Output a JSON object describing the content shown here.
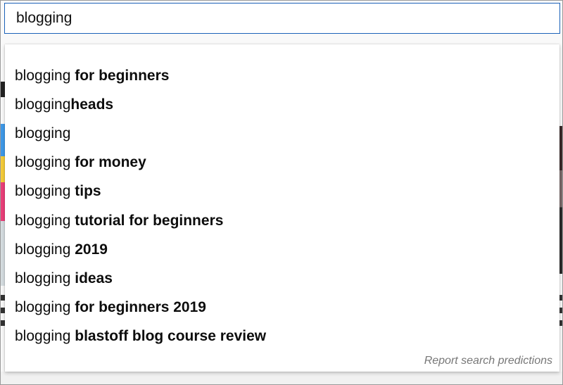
{
  "search": {
    "value": "blogging"
  },
  "suggestions": [
    {
      "base": "blogging",
      "rest": " for beginners"
    },
    {
      "base": "blogging",
      "rest": "heads"
    },
    {
      "base": "blogging",
      "rest": ""
    },
    {
      "base": "blogging",
      "rest": " for money"
    },
    {
      "base": "blogging",
      "rest": " tips"
    },
    {
      "base": "blogging",
      "rest": " tutorial for beginners"
    },
    {
      "base": "blogging",
      "rest": " 2019"
    },
    {
      "base": "blogging",
      "rest": " ideas"
    },
    {
      "base": "blogging",
      "rest": " for beginners 2019"
    },
    {
      "base": "blogging",
      "rest": " blastoff blog course review"
    }
  ],
  "report_link": "Report search predictions",
  "colors": {
    "focus_border": "#1c62b9",
    "text": "#0d0d0d",
    "muted": "#777777"
  }
}
